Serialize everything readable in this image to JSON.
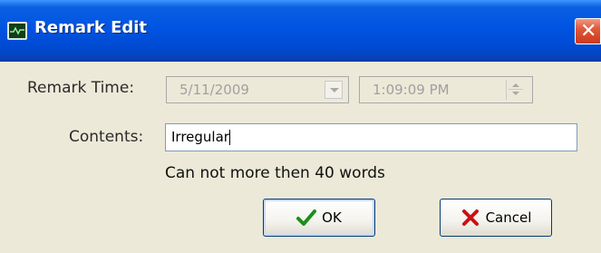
{
  "window": {
    "title": "Remark Edit",
    "close_glyph": "✕"
  },
  "form": {
    "remark_time_label": "Remark Time:",
    "date_value": "5/11/2009",
    "time_value": "1:09:09 PM",
    "contents_label": "Contents:",
    "contents_value": "Irregular",
    "hint": "Can not more then 40 words"
  },
  "buttons": {
    "ok_label": "OK",
    "cancel_label": "Cancel"
  },
  "icons": {
    "app": "chart-icon",
    "ok": "checkmark-icon",
    "cancel": "x-mark-icon",
    "ok_color": "#1a8f1a",
    "cancel_color": "#cc1111"
  }
}
